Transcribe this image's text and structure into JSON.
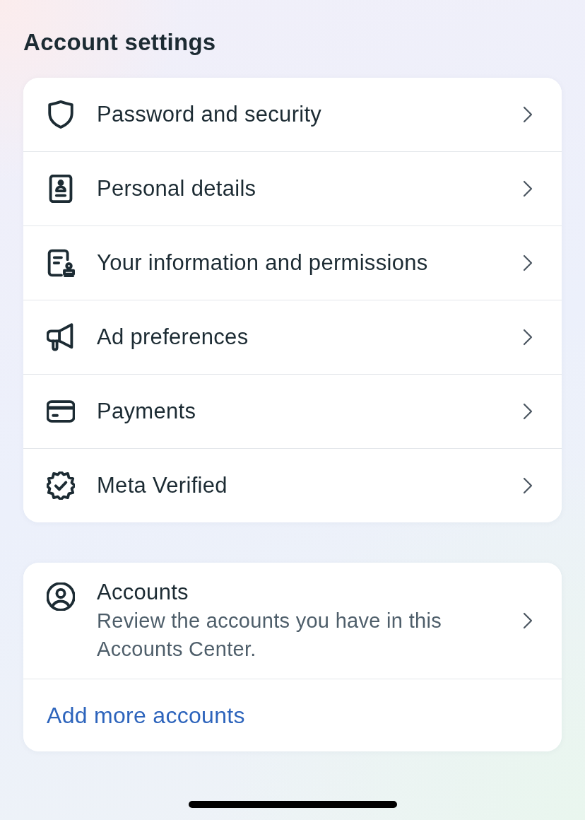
{
  "title": "Account settings",
  "settings_items": [
    {
      "label": "Password and security"
    },
    {
      "label": "Personal details"
    },
    {
      "label": "Your information and permissions"
    },
    {
      "label": "Ad preferences"
    },
    {
      "label": "Payments"
    },
    {
      "label": "Meta Verified"
    }
  ],
  "accounts_card": {
    "title": "Accounts",
    "description": "Review the accounts you have in this Accounts Center.",
    "link": "Add more accounts"
  }
}
